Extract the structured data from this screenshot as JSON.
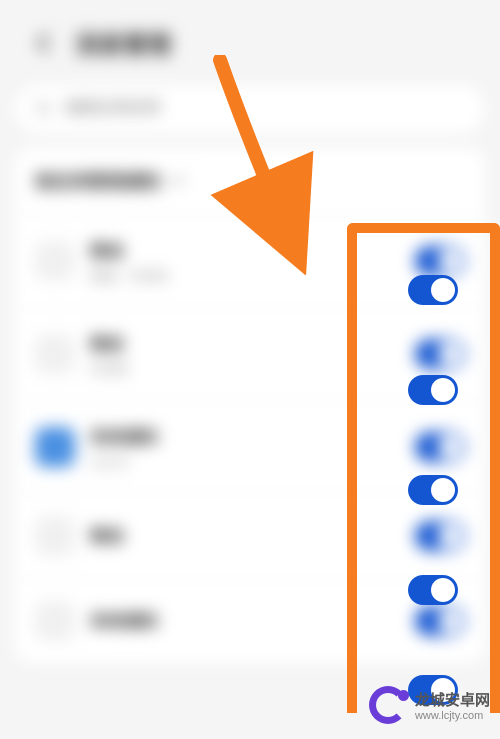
{
  "header": {
    "title": "消息管理"
  },
  "search": {
    "placeholder": "搜索应用名称"
  },
  "panel": {
    "title": "按应用管理通知"
  },
  "items": [
    {
      "title": "微信",
      "subtitle": "横幅、声音等",
      "toggle": true,
      "icon_class": ""
    },
    {
      "title": "微信",
      "subtitle": "声音等",
      "toggle": true,
      "icon_class": ""
    },
    {
      "title": "系统通知",
      "subtitle": "已允许",
      "toggle": true,
      "icon_class": "blue"
    },
    {
      "title": "微信",
      "subtitle": "",
      "toggle": true,
      "icon_class": ""
    },
    {
      "title": "系统通知",
      "subtitle": "",
      "toggle": true,
      "icon_class": ""
    }
  ],
  "watermark": {
    "line1": "龙城安卓网",
    "line2": "www.lcjty.com"
  },
  "sharp_toggle_positions": [
    275,
    375,
    475,
    575,
    675
  ]
}
